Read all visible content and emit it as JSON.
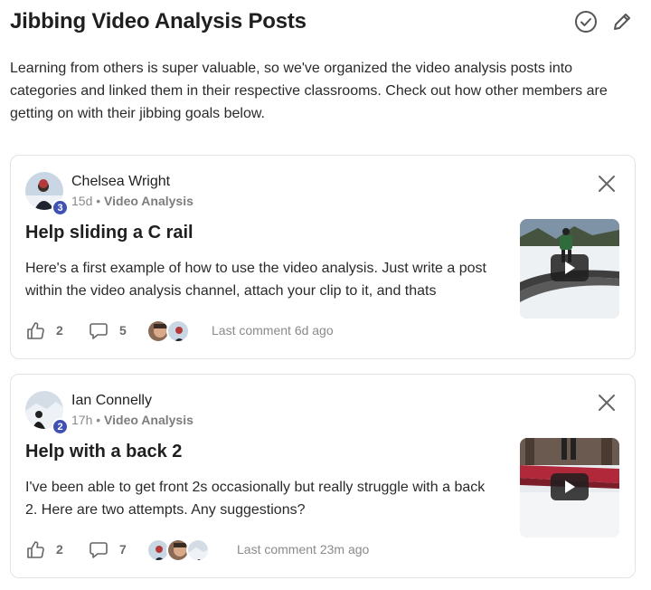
{
  "page": {
    "title": "Jibbing Video Analysis Posts",
    "intro": "Learning from others is super valuable, so we've organized the video analysis posts into categories and linked them in their respective classrooms. Check out how other members are getting on with their jibbing goals below."
  },
  "header_icons": [
    "check-circle-icon",
    "pencil-icon"
  ],
  "posts": [
    {
      "author": "Chelsea Wright",
      "level": "3",
      "age": "15d",
      "separator": "•",
      "category": "Video Analysis",
      "title": "Help sliding a C rail",
      "body": "Here's a first example of how to use the video analysis. Just write a post within the video analysis channel, attach your clip to it, and thats",
      "likes": "2",
      "comments": "5",
      "last_comment": "Last comment 6d ago"
    },
    {
      "author": "Ian Connelly",
      "level": "2",
      "age": "17h",
      "separator": "•",
      "category": "Video Analysis",
      "title": "Help with a back 2",
      "body": "I've been able to get front 2s occasionally but really struggle with a back 2. Here are two attempts. Any suggestions?",
      "likes": "2",
      "comments": "7",
      "last_comment": "Last comment 23m ago"
    }
  ],
  "colors": {
    "badge": "#3f51b5",
    "text": "#1f1f1f",
    "muted": "#8a8a8a",
    "border": "#e3e3e3"
  }
}
